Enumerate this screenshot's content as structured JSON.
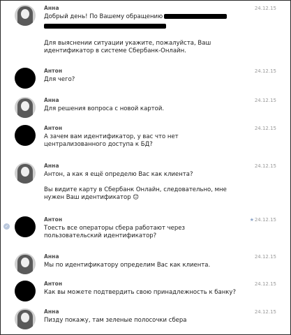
{
  "messages": [
    {
      "author": "Анна",
      "time": "24.12.15",
      "lines": [
        "Добрый день! По Вашему обращению"
      ]
    },
    {
      "lines": [
        "Для выяснении ситуации укажите, пожалуйста, Ваш",
        "идентификатор в системе Сбербанк-Онлайн."
      ]
    },
    {
      "author": "Антон",
      "time": "24.12.15",
      "lines": [
        "Для чего?"
      ]
    },
    {
      "author": "Анна",
      "time": "24.12.15",
      "lines": [
        "Для решения вопроса с новой картой."
      ]
    },
    {
      "author": "Антон",
      "time": "24.12.15",
      "lines": [
        "А зачем вам идентификатор, у вас что нет",
        "централизованного доступа к БД?"
      ]
    },
    {
      "author": "Анна",
      "time": "24.12.15",
      "lines": [
        "Антон, а как я ещё определю Вас как клиента?"
      ]
    },
    {
      "lines": [
        "Вы видите карту в Сбербанк Онлайн, следовательно, мне",
        "нужен Ваш идентификатор 😊"
      ]
    },
    {
      "author": "Антон",
      "time": "24.12.15",
      "star": "★",
      "lines": [
        "Тоесть все операторы сбера работают через",
        "пользовательский идентификатор?"
      ]
    },
    {
      "author": "Анна",
      "time": "24.12.15",
      "lines": [
        "Мы по идентификатору определим Вас как клиента."
      ]
    },
    {
      "author": "Антон",
      "time": "24.12.15",
      "lines": [
        "Как вы можете подтвердить свою принадлежность к банку?"
      ]
    },
    {
      "author": "Анна",
      "time": "24.12.15",
      "lines": [
        "Пизду покажу, там зеленые полосочки сбера"
      ]
    }
  ]
}
